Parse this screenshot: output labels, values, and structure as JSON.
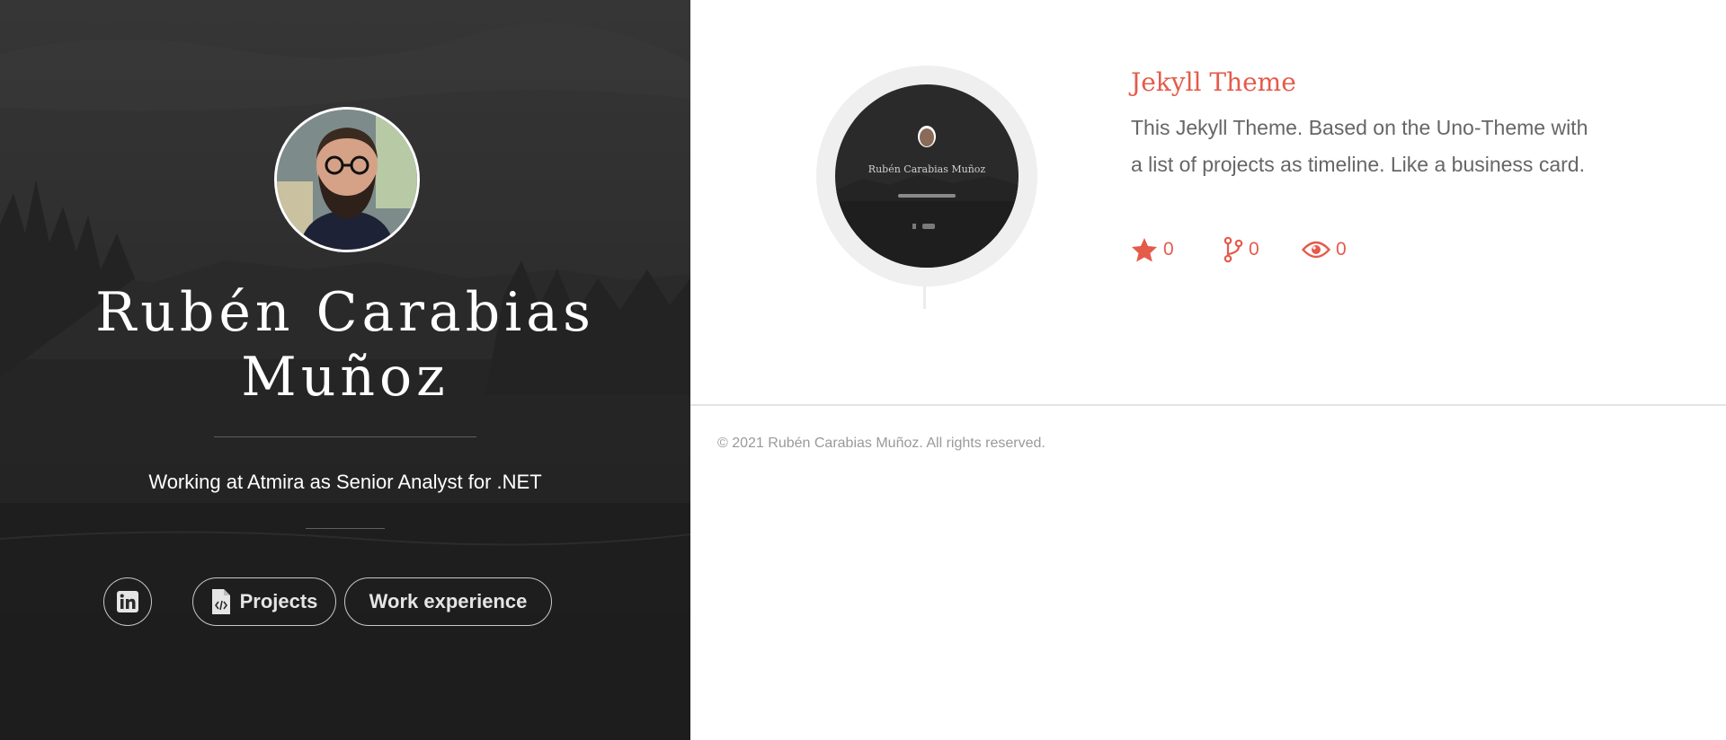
{
  "cover": {
    "name": "Rubén Carabias Muñoz",
    "subtitle": "Working at Atmira as Senior Analyst for .NET",
    "nav": {
      "linkedin_icon": "linkedin-icon",
      "projects_label": "Projects",
      "projects_icon": "code-file-icon",
      "work_label": "Work experience"
    }
  },
  "projects": [
    {
      "title": "Jekyll Theme",
      "description": "This Jekyll Theme. Based on the Uno-Theme with a list of projects as timeline. Like a business card.",
      "thumbnail": {
        "name": "Rubén Carabias Muñoz"
      },
      "stars": "0",
      "forks": "0",
      "watchers": "0"
    }
  ],
  "footer": {
    "copyright": "© 2021 Rubén Carabias Muñoz. All rights reserved."
  },
  "colors": {
    "accent": "#e45b4b",
    "cover_bg": "#2b2b2b",
    "text_muted": "#666666",
    "footer_text": "#9a9a9a"
  }
}
